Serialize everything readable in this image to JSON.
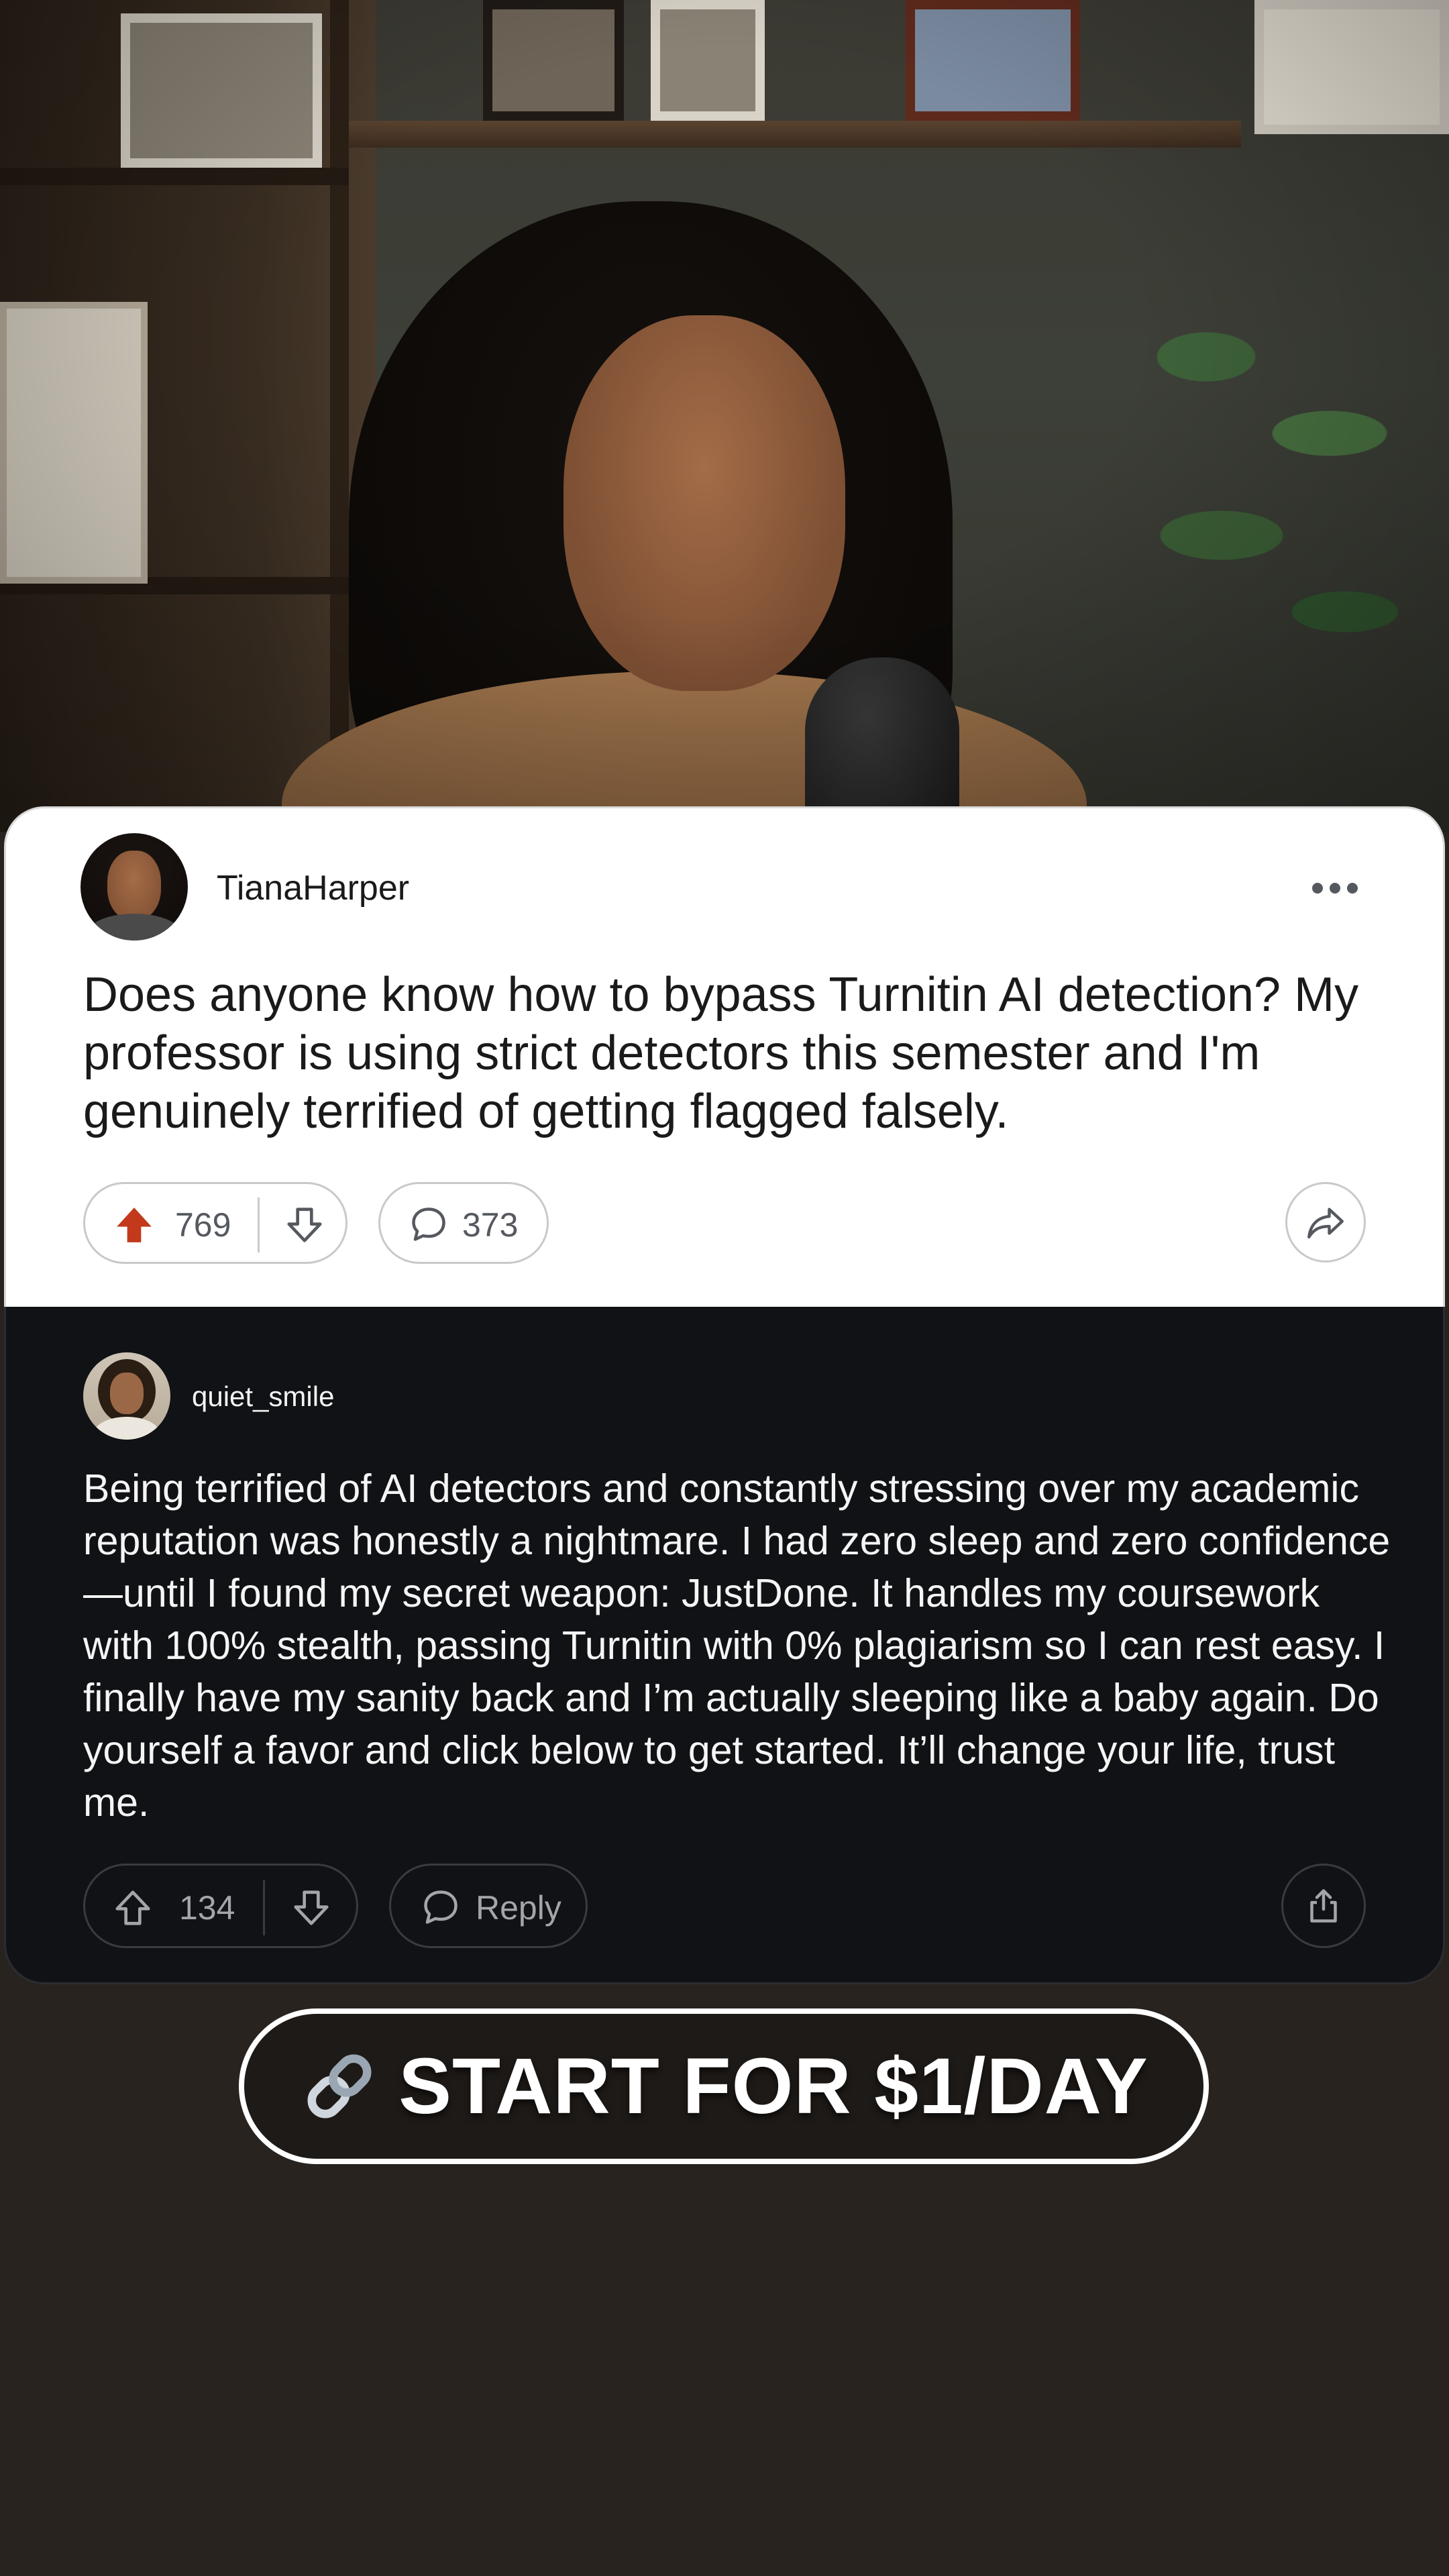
{
  "post": {
    "username": "TianaHarper",
    "body": "Does anyone know how to bypass Turnitin AI detection? My professor is using strict detectors this semester and I'm genuinely terrified of getting flagged falsely.",
    "upvotes": "769",
    "comments": "373",
    "upvote_color": "#c2391b"
  },
  "reply": {
    "username": "quiet_smile",
    "body": "Being terrified of AI detectors and constantly stressing over my academic reputation was honestly a nightmare. I had zero sleep and zero confidence—until I found my secret weapon: JustDone. It handles my coursework with 100% stealth, passing Turnitin with 0% plagiarism so I can rest easy. I finally have my sanity back and I’m actually sleeping like a baby again. Do yourself a favor and click below to get started. It’ll change your life, trust me.",
    "upvotes": "134",
    "reply_label": "Reply"
  },
  "cta": {
    "label": "START FOR $1/DAY",
    "icon": "link-icon"
  },
  "icons": {
    "more": "more-options-icon",
    "upvote": "upvote-arrow-icon",
    "downvote": "downvote-arrow-icon",
    "comment": "comment-bubble-icon",
    "share": "share-icon"
  }
}
